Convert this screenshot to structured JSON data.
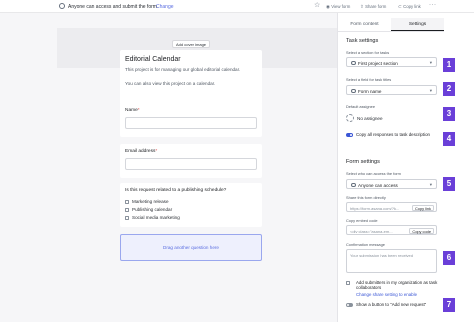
{
  "topbar": {
    "access_text": "Anyone can access and submit the form.",
    "change_link": "Change",
    "view_form": "View form",
    "share_form": "Share form",
    "copy_link": "Copy link",
    "more": "···"
  },
  "canvas": {
    "add_cover_image": "Add cover image",
    "title": "Editorial Calendar",
    "description_1": "This project is for managing our global editorial calendar.",
    "description_2": "You can also view this project on a calendar.",
    "questions": [
      {
        "label": "Name",
        "required": "*"
      },
      {
        "label": "Email address",
        "required": "*"
      }
    ],
    "schedule_question": "Is this request related to a publishing schedule?",
    "schedule_options": [
      "Marketing release",
      "Publishing calendar",
      "Social media marketing"
    ],
    "drag_text": "Drag another question here"
  },
  "panel": {
    "tabs": [
      "Form content",
      "Settings"
    ],
    "active_tab": "Settings",
    "task_settings_title": "Task settings",
    "section_label": "Select a section for tasks",
    "section_value": "First project section",
    "field_label": "Select a field for task titles",
    "field_value": "Form name",
    "assignee_label": "Default assignee",
    "assignee_value": "No assignee",
    "copy_responses": "Copy all responses to task description",
    "form_settings_title": "Form settings",
    "access_label": "Select who can access the form",
    "access_value": "Anyone can access",
    "share_label": "Share this form directly",
    "share_url": "https://form.asana.com/?k...",
    "copy_link_btn": "Copy link",
    "embed_label": "Copy embed code",
    "embed_code": "<div class=\"asana-em...",
    "copy_code_btn": "Copy code",
    "confirm_label": "Confirmation message",
    "confirm_placeholder": "Your submission has been received",
    "collab_text": "Add submitters in my organization as task collaborators",
    "collab_link": "Change share setting to enable",
    "add_new_text": "Show a button to \"Add new request\""
  },
  "badges": [
    "1",
    "2",
    "3",
    "4",
    "5",
    "6",
    "7"
  ],
  "colors": {
    "accent": "#3b57d6",
    "badge": "#6a3fd8",
    "link": "#5b6ee1"
  }
}
